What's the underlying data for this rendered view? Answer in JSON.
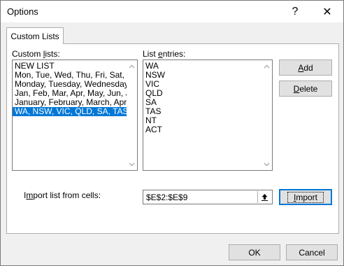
{
  "window": {
    "title": "Options"
  },
  "titlebar": {
    "help_glyph": "?",
    "close_glyph": "✕"
  },
  "tab": {
    "label": "Custom Lists"
  },
  "custom_lists": {
    "label_pre": "Custom ",
    "label_accel": "l",
    "label_post": "ists:",
    "items": [
      "NEW LIST",
      "Mon, Tue, Wed, Thu, Fri, Sat, Sun",
      "Monday, Tuesday, Wednesday, Thursday",
      "Jan, Feb, Mar, Apr, May, Jun, Jul",
      "January, February, March, April, May",
      "WA, NSW, VIC, QLD, SA, TAS, NT, ACT"
    ],
    "selected_index": 5
  },
  "list_entries": {
    "label_pre": "List ",
    "label_accel": "e",
    "label_post": "ntries:",
    "items": [
      "WA",
      "NSW",
      "VIC",
      "QLD",
      "SA",
      "TAS",
      "NT",
      "ACT"
    ]
  },
  "buttons": {
    "add_accel": "A",
    "add_rest": "dd",
    "delete_accel": "D",
    "delete_rest": "elete",
    "import_accel": "I",
    "import_rest": "mport",
    "ok": "OK",
    "cancel": "Cancel"
  },
  "import_from": {
    "label_pre": "I",
    "label_accel": "m",
    "label_post": "port list from cells:",
    "value": "$E$2:$E$9"
  },
  "colors": {
    "selection": "#0078d7",
    "button_face": "#e1e1e1",
    "dialog_bg": "#f0f0f0"
  }
}
